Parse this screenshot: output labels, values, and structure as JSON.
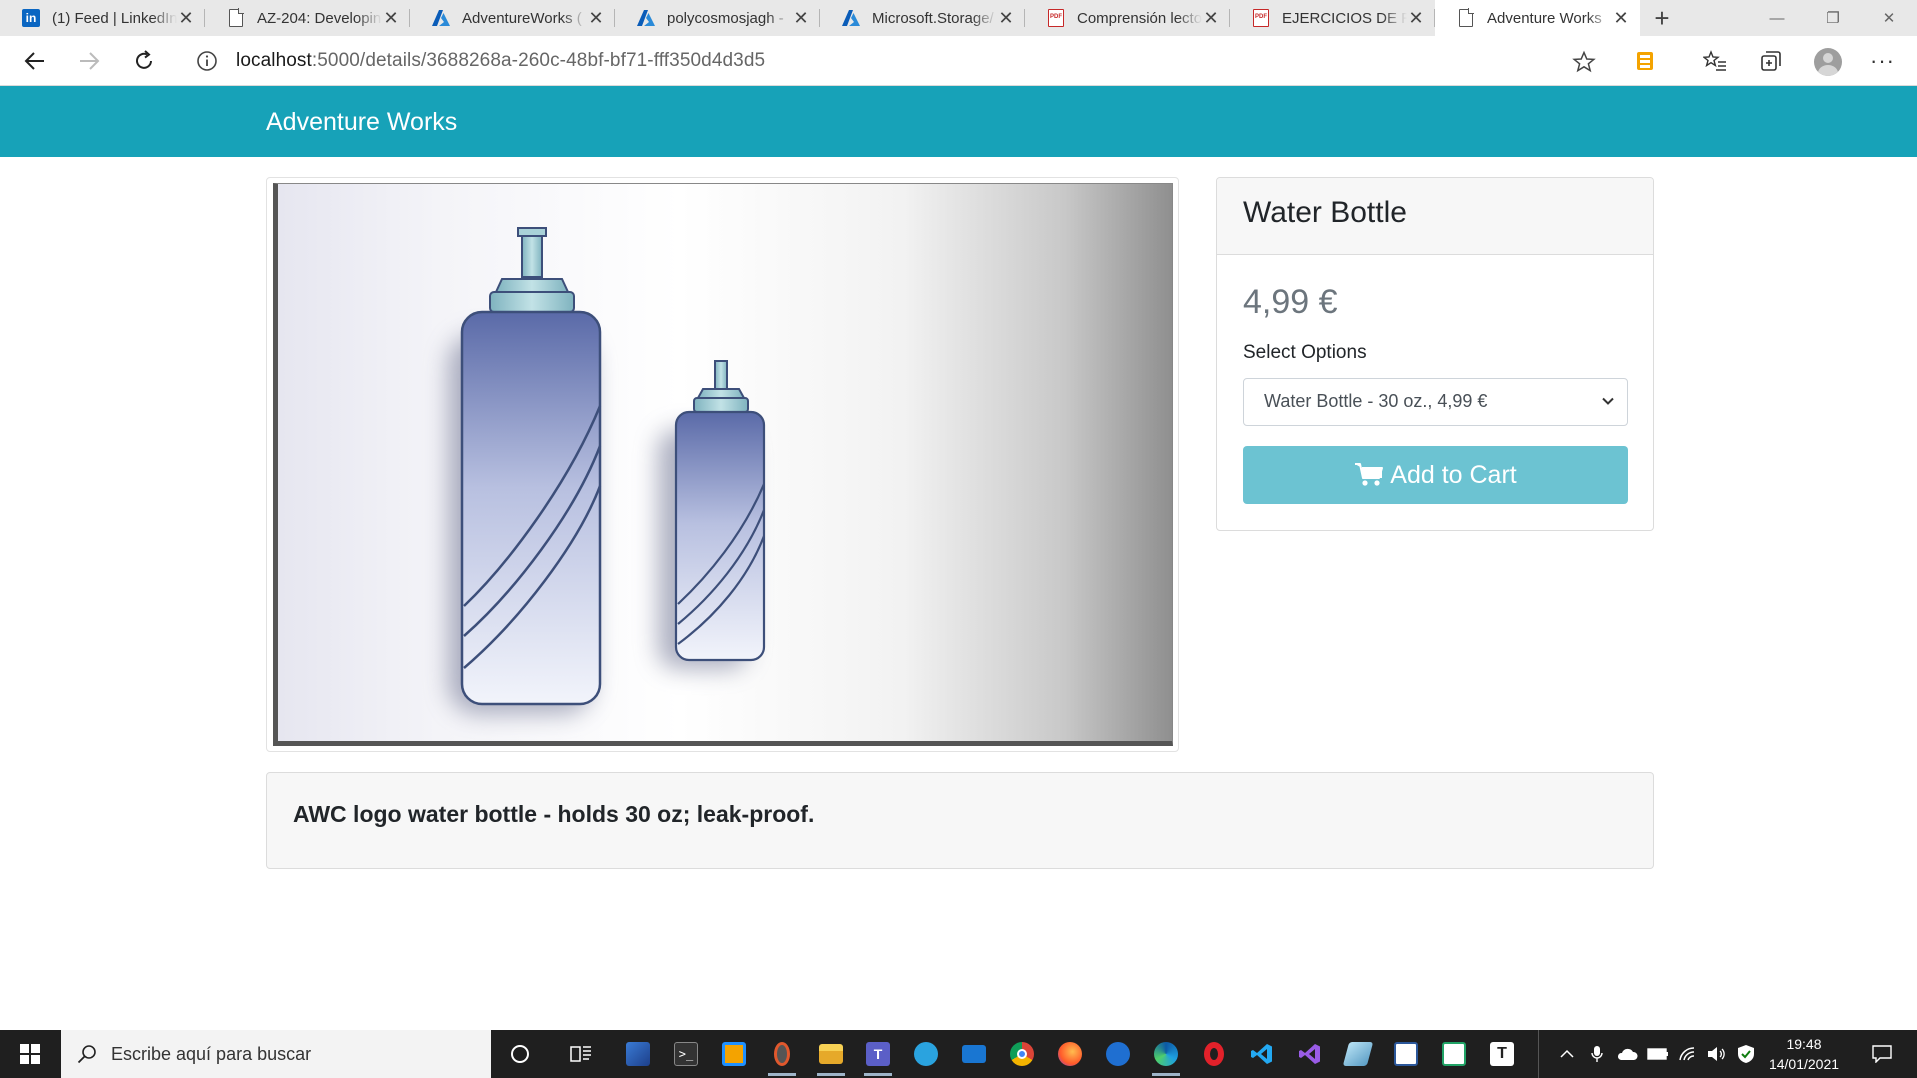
{
  "browser": {
    "tabs": [
      {
        "title": "(1) Feed | LinkedIn",
        "icon": "linkedin-icon"
      },
      {
        "title": "AZ-204: Developing",
        "icon": "page-icon"
      },
      {
        "title": "AdventureWorks (",
        "icon": "azure-icon"
      },
      {
        "title": "polycosmosjagh -",
        "icon": "azure-icon"
      },
      {
        "title": "Microsoft.Storage/",
        "icon": "azure-icon"
      },
      {
        "title": "Comprensión lecto",
        "icon": "pdf-icon"
      },
      {
        "title": "EJERCICIOS DE RE",
        "icon": "pdf-icon"
      },
      {
        "title": "Adventure Works",
        "icon": "page-icon",
        "active": true
      }
    ],
    "close_glyph": "✕",
    "new_tab_glyph": "+",
    "window_controls": {
      "minimize": "—",
      "restore": "❐",
      "close": "✕"
    },
    "url_host": "localhost",
    "url_rest": ":5000/details/3688268a-260c-48bf-bf71-fff350d4d3d5",
    "more_glyph": "···"
  },
  "site": {
    "brand": "Adventure Works"
  },
  "product": {
    "name": "Water Bottle",
    "price": "4,99 €",
    "options_label": "Select Options",
    "selected_option": "Water Bottle - 30 oz., 4,99 €",
    "add_to_cart_label": "Add to Cart",
    "description": "AWC logo water bottle - holds 30 oz; leak-proof.",
    "image_alt": "Water Bottle"
  },
  "colors": {
    "navbar": "#17a2b8",
    "cart_button": "#6cc3d2",
    "price": "#6c757d"
  },
  "taskbar": {
    "search_placeholder": "Escribe aquí para buscar",
    "time": "19:48",
    "date": "14/01/2021"
  }
}
